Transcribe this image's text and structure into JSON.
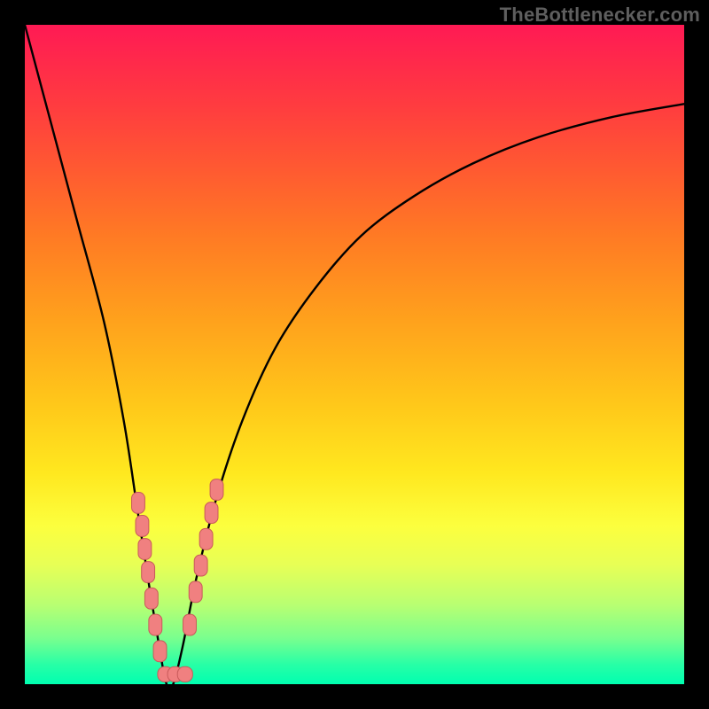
{
  "watermark": {
    "text": "TheBottlenecker.com"
  },
  "frame": {
    "outer_w": 800,
    "outer_h": 800,
    "border": 28
  },
  "chart_data": {
    "type": "line",
    "title": "",
    "xlabel": "",
    "ylabel": "",
    "ylim": [
      0,
      100
    ],
    "xlim": [
      0,
      100
    ],
    "series": [
      {
        "name": "bottleneck-curve",
        "x": [
          0,
          4,
          8,
          12,
          15,
          17,
          19,
          20.5,
          21.5,
          22.5,
          24,
          26,
          29,
          33,
          38,
          44,
          51,
          59,
          68,
          78,
          89,
          100
        ],
        "values": [
          100,
          85,
          70,
          55,
          40,
          27,
          14,
          5,
          0,
          0,
          6,
          16,
          28,
          40,
          51,
          60,
          68,
          74,
          79,
          83,
          86,
          88
        ]
      }
    ],
    "markers": {
      "name": "dense-sample-points",
      "shape": "rounded-rect",
      "fill": "#f08080",
      "stroke": "#c85a5a",
      "points": [
        {
          "x": 17.2,
          "y": 27.5,
          "w": 2.0,
          "h": 3.2
        },
        {
          "x": 17.8,
          "y": 24.0,
          "w": 2.0,
          "h": 3.2
        },
        {
          "x": 18.2,
          "y": 20.5,
          "w": 2.0,
          "h": 3.2
        },
        {
          "x": 18.7,
          "y": 17.0,
          "w": 2.0,
          "h": 3.2
        },
        {
          "x": 19.2,
          "y": 13.0,
          "w": 2.0,
          "h": 3.2
        },
        {
          "x": 19.8,
          "y": 9.0,
          "w": 2.0,
          "h": 3.2
        },
        {
          "x": 20.5,
          "y": 5.0,
          "w": 2.0,
          "h": 3.2
        },
        {
          "x": 21.3,
          "y": 1.5,
          "w": 2.3,
          "h": 2.3
        },
        {
          "x": 22.8,
          "y": 1.5,
          "w": 2.3,
          "h": 2.3
        },
        {
          "x": 24.3,
          "y": 1.5,
          "w": 2.3,
          "h": 2.3
        },
        {
          "x": 25.0,
          "y": 9.0,
          "w": 2.0,
          "h": 3.2
        },
        {
          "x": 25.9,
          "y": 14.0,
          "w": 2.0,
          "h": 3.2
        },
        {
          "x": 26.7,
          "y": 18.0,
          "w": 2.0,
          "h": 3.2
        },
        {
          "x": 27.5,
          "y": 22.0,
          "w": 2.0,
          "h": 3.2
        },
        {
          "x": 28.3,
          "y": 26.0,
          "w": 2.0,
          "h": 3.2
        },
        {
          "x": 29.1,
          "y": 29.5,
          "w": 2.0,
          "h": 3.2
        }
      ]
    },
    "gradient_stops": [
      {
        "pct": 0,
        "color": "#ff1a54"
      },
      {
        "pct": 12,
        "color": "#ff3b40"
      },
      {
        "pct": 22,
        "color": "#ff5a31"
      },
      {
        "pct": 32,
        "color": "#ff7a24"
      },
      {
        "pct": 45,
        "color": "#ffa21c"
      },
      {
        "pct": 58,
        "color": "#ffc91a"
      },
      {
        "pct": 68,
        "color": "#ffe81f"
      },
      {
        "pct": 76,
        "color": "#fcff3e"
      },
      {
        "pct": 82,
        "color": "#e7ff56"
      },
      {
        "pct": 88,
        "color": "#b8ff72"
      },
      {
        "pct": 93,
        "color": "#7aff8e"
      },
      {
        "pct": 97,
        "color": "#28ffa6"
      },
      {
        "pct": 100,
        "color": "#00ffb0"
      }
    ]
  }
}
